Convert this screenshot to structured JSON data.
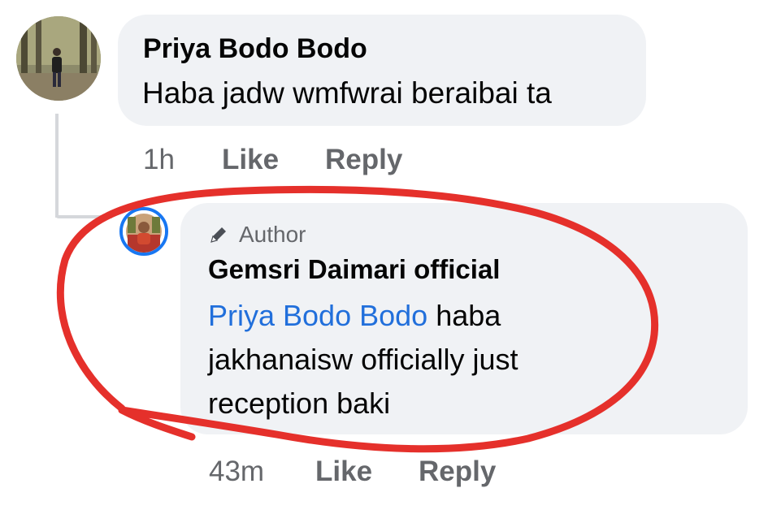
{
  "comment": {
    "author_name": "Priya Bodo Bodo",
    "text": "Haba jadw wmfwrai beraibai ta",
    "time": "1h",
    "like_label": "Like",
    "reply_label": "Reply"
  },
  "reply": {
    "badge_label": "Author",
    "badge_icon": "pencil-icon",
    "author_name": "Gemsri Daimari official",
    "mention": "Priya Bodo Bodo",
    "text_line1": "haba",
    "text_line2": "jakhanaisw officially just",
    "text_line3": "reception baki",
    "time": "43m",
    "like_label": "Like",
    "reply_label": "Reply"
  },
  "colors": {
    "bubble": "#f0f2f5",
    "meta_text": "#65676b",
    "mention": "#216fdb",
    "author_ring": "#1877f2",
    "annotation": "#e5302b"
  }
}
